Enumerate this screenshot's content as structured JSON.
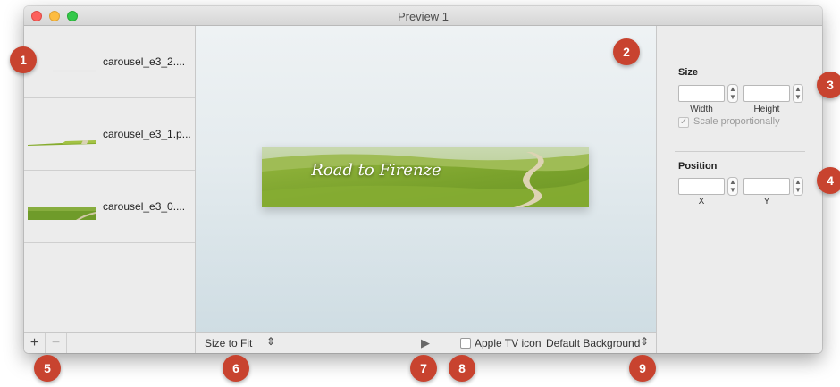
{
  "window": {
    "title": "Preview 1"
  },
  "sidebar": {
    "items": [
      {
        "label": "carousel_e3_2...."
      },
      {
        "label": "carousel_e3_1.p..."
      },
      {
        "label": "carousel_e3_0...."
      }
    ],
    "add_label": "+",
    "remove_label": "−"
  },
  "canvas": {
    "banner_text": "Road to Firenze"
  },
  "bottombar": {
    "size_mode": "Size to Fit",
    "play_glyph": "▶",
    "apple_tv_label": "Apple TV icon",
    "background": "Default Background"
  },
  "inspector": {
    "size_title": "Size",
    "width_caption": "Width",
    "height_caption": "Height",
    "width_value": "",
    "height_value": "",
    "scale_label": "Scale proportionally",
    "position_title": "Position",
    "x_caption": "X",
    "y_caption": "Y",
    "x_value": "",
    "y_value": ""
  },
  "callouts": [
    "1",
    "2",
    "3",
    "4",
    "5",
    "6",
    "7",
    "8",
    "9"
  ],
  "colors": {
    "callout": "#c8432f",
    "grass": "#7fa832"
  }
}
